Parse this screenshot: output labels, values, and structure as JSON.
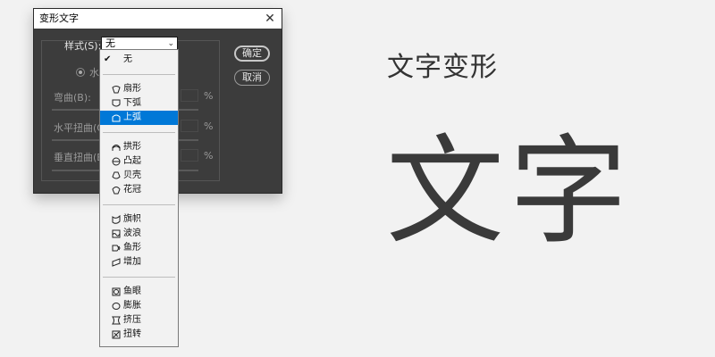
{
  "dialog": {
    "title": "变形文字",
    "close_glyph": "✕",
    "style_label": "样式(S):",
    "style_value": "无",
    "radio_label": "水平",
    "params": [
      {
        "label": "弯曲(B):",
        "unit": "%"
      },
      {
        "label": "水平扭曲(O):",
        "unit": "%"
      },
      {
        "label": "垂直扭曲(E):",
        "unit": "%"
      }
    ],
    "ok_label": "确定",
    "cancel_label": "取消"
  },
  "dropdown": {
    "check_glyph": "✔",
    "selected_index": 3,
    "items": [
      {
        "label": "无",
        "icon": "none"
      },
      {
        "label": "扇形",
        "icon": "arc-icon"
      },
      {
        "label": "下弧",
        "icon": "arc-lower-icon"
      },
      {
        "label": "上弧",
        "icon": "arc-upper-icon"
      },
      {
        "label": "拱形",
        "icon": "arch-icon"
      },
      {
        "label": "凸起",
        "icon": "bulge-icon"
      },
      {
        "label": "贝壳",
        "icon": "shell-icon"
      },
      {
        "label": "花冠",
        "icon": "flower-icon"
      },
      {
        "label": "旗帜",
        "icon": "flag-icon"
      },
      {
        "label": "波浪",
        "icon": "wave-icon"
      },
      {
        "label": "鱼形",
        "icon": "fish-icon"
      },
      {
        "label": "增加",
        "icon": "rise-icon"
      },
      {
        "label": "鱼眼",
        "icon": "fisheye-icon"
      },
      {
        "label": "膨胀",
        "icon": "inflate-icon"
      },
      {
        "label": "挤压",
        "icon": "squeeze-icon"
      },
      {
        "label": "扭转",
        "icon": "twist-icon"
      }
    ]
  },
  "heading": "文字变形",
  "big_text": "文字",
  "colors": {
    "selected": "#0078d7",
    "dialog_bg": "#3c3c3c",
    "page_bg": "#f2f2f2"
  }
}
